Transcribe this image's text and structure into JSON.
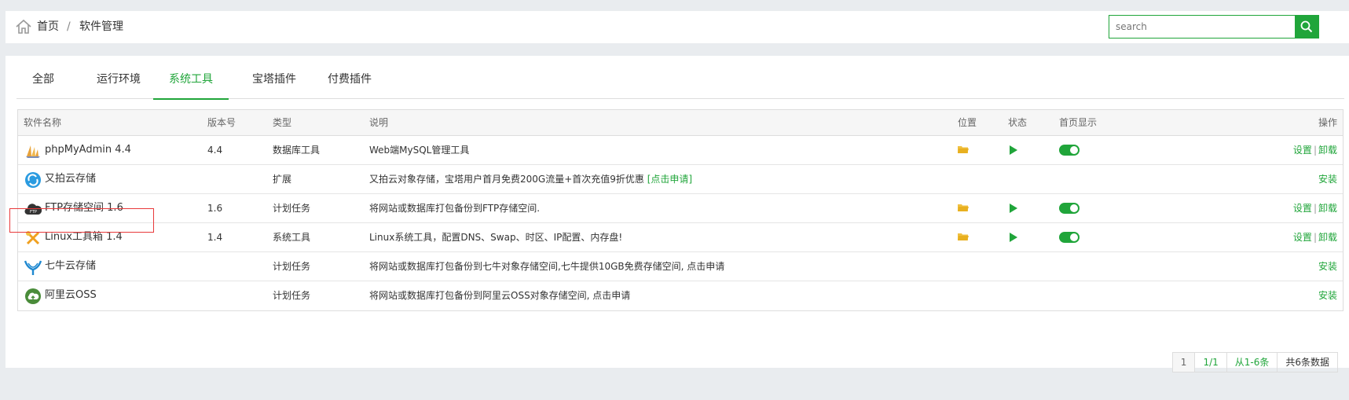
{
  "breadcrumb": {
    "home": "首页",
    "separator": "/",
    "current": "软件管理"
  },
  "search": {
    "placeholder": "search"
  },
  "tabs": [
    "全部",
    "运行环境",
    "系统工具",
    "宝塔插件",
    "付费插件"
  ],
  "active_tab": "系统工具",
  "table": {
    "headers": {
      "name": "软件名称",
      "version": "版本号",
      "type": "类型",
      "desc": "说明",
      "location": "位置",
      "state": "状态",
      "home": "首页显示",
      "ops": "操作"
    },
    "rows": [
      {
        "name": "phpMyAdmin 4.4",
        "version": "4.4",
        "type": "数据库工具",
        "desc": "Web端MySQL管理工具",
        "desc_link": "",
        "icon": "phpmyadmin-icon",
        "installed": true
      },
      {
        "name": "又拍云存储",
        "version": "",
        "type": "扩展",
        "desc": "又拍云对象存储，宝塔用户首月免费200G流量+首次充值9折优惠 ",
        "desc_link": "[点击申请]",
        "icon": "upyun-icon",
        "installed": false
      },
      {
        "name": "FTP存储空间 1.6",
        "version": "1.6",
        "type": "计划任务",
        "desc": "将网站或数据库打包备份到FTP存储空间.",
        "desc_link": "",
        "icon": "ftp-icon",
        "installed": true
      },
      {
        "name": "Linux工具箱 1.4",
        "version": "1.4",
        "type": "系统工具",
        "desc": "Linux系统工具，配置DNS、Swap、时区、IP配置、内存盘!",
        "desc_link": "",
        "icon": "linux-toolbox-icon",
        "installed": true
      },
      {
        "name": "七牛云存储",
        "version": "",
        "type": "计划任务",
        "desc": "将网站或数据库打包备份到七牛对象存储空间,七牛提供10GB免费存储空间, 点击申请",
        "desc_link": "",
        "icon": "qiniu-icon",
        "installed": false
      },
      {
        "name": "阿里云OSS",
        "version": "",
        "type": "计划任务",
        "desc": "将网站或数据库打包备份到阿里云OSS对象存储空间, 点击申请",
        "desc_link": "",
        "icon": "aliyun-oss-icon",
        "installed": false
      }
    ],
    "op_settings": "设置",
    "op_separator": "|",
    "op_uninstall": "卸载",
    "op_install": "安装"
  },
  "pagination": {
    "current": "1",
    "pages": "1/1",
    "range": "从1-6条",
    "total": "共6条数据"
  },
  "colors": {
    "accent": "#20a53a",
    "highlight": "#e8393b",
    "folder": "#f0c040"
  }
}
